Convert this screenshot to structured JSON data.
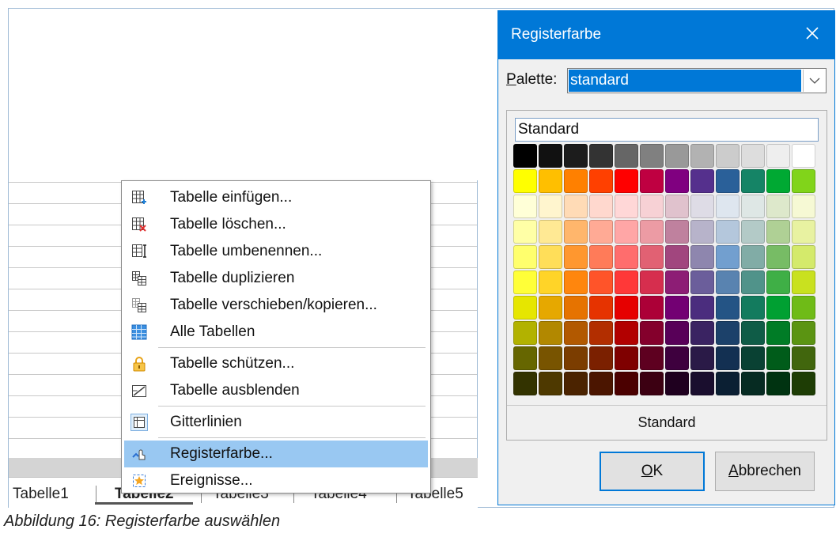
{
  "sheet": {
    "tabs": [
      "Tabelle1",
      "Tabelle2",
      "Tabelle3",
      "Tabelle4",
      "Tabelle5"
    ],
    "active_tab_index": 1
  },
  "context_menu": {
    "items": [
      {
        "label": "Tabelle einfügen...",
        "icon": "insert-sheet-icon"
      },
      {
        "label": "Tabelle löschen...",
        "icon": "delete-sheet-icon"
      },
      {
        "label": "Tabelle umbenennen...",
        "icon": "rename-sheet-icon"
      },
      {
        "label": "Tabelle duplizieren",
        "icon": "duplicate-sheet-icon"
      },
      {
        "label": "Tabelle verschieben/kopieren...",
        "icon": "move-copy-sheet-icon"
      },
      {
        "label": "Alle Tabellen",
        "icon": "all-sheets-icon"
      },
      {
        "label": "Tabelle schützen...",
        "icon": "lock-icon"
      },
      {
        "label": "Tabelle ausblenden",
        "icon": "hide-sheet-icon"
      },
      {
        "label": "Gitterlinien",
        "icon": "gridlines-icon"
      },
      {
        "label": "Registerfarbe...",
        "icon": "tab-color-icon"
      },
      {
        "label": "Ereignisse...",
        "icon": "events-icon"
      }
    ],
    "highlighted_index": 9
  },
  "dialog": {
    "title": "Registerfarbe",
    "palette_label": "Palette:",
    "palette_value": "standard",
    "color_name": "Standard",
    "palette_footer": "Standard",
    "ok_label": "OK",
    "cancel_label": "Abbrechen",
    "swatch_rows": [
      [
        "#000000",
        "#111111",
        "#1c1c1c",
        "#333333",
        "#666666",
        "#808080",
        "#999999",
        "#b2b2b2",
        "#cccccc",
        "#dddddd",
        "#eeeeee",
        "#ffffff"
      ],
      [
        "#ffff00",
        "#ffbf00",
        "#ff8000",
        "#ff4000",
        "#ff0000",
        "#bf0041",
        "#800080",
        "#55308d",
        "#2a6099",
        "#158466",
        "#00a933",
        "#81d41a"
      ],
      [
        "#ffffd7",
        "#fff5ce",
        "#ffdbb6",
        "#ffd8ce",
        "#ffd7d7",
        "#f7d1d5",
        "#e0c2cd",
        "#dedce6",
        "#dee6ef",
        "#dee7e5",
        "#dde8cb",
        "#f6f9d4"
      ],
      [
        "#ffffa6",
        "#ffe994",
        "#ffb66c",
        "#ffaa95",
        "#ffa6a6",
        "#ec9ba4",
        "#bf819e",
        "#b7b3ca",
        "#b4c7dc",
        "#b3cac7",
        "#afd095",
        "#e8f2a1"
      ],
      [
        "#ffff6d",
        "#ffde59",
        "#ff972f",
        "#ff7b59",
        "#ff6d6d",
        "#e16173",
        "#a1467e",
        "#8e86ae",
        "#729fcf",
        "#81aca6",
        "#77bc65",
        "#d4ea6b"
      ],
      [
        "#ffff38",
        "#ffd428",
        "#ff860d",
        "#ff5429",
        "#ff3838",
        "#d62e4e",
        "#8d1d75",
        "#6b5e9b",
        "#5983b0",
        "#50938a",
        "#3faf46",
        "#c9e11f"
      ],
      [
        "#e6e600",
        "#e6a800",
        "#e67300",
        "#e63300",
        "#e60000",
        "#ac0037",
        "#730073",
        "#4b2d7e",
        "#245485",
        "#137b5e",
        "#00a032",
        "#6fbb17"
      ],
      [
        "#b2b200",
        "#b28800",
        "#b25900",
        "#b22e00",
        "#b20000",
        "#84002c",
        "#580058",
        "#3a2362",
        "#1c416a",
        "#0f5c47",
        "#007c26",
        "#5b9412"
      ],
      [
        "#666600",
        "#785400",
        "#7b3d00",
        "#7b2000",
        "#7f0000",
        "#5e0020",
        "#3e003e",
        "#2a1a47",
        "#133052",
        "#094133",
        "#005c1a",
        "#41660d"
      ],
      [
        "#333300",
        "#4e3900",
        "#4b2300",
        "#4b1500",
        "#4b0000",
        "#3c0012",
        "#1f001f",
        "#1a0e2e",
        "#0b1f33",
        "#062b22",
        "#003311",
        "#1e3d05"
      ]
    ]
  },
  "caption": "Abbildung 16: Registerfarbe auswählen"
}
